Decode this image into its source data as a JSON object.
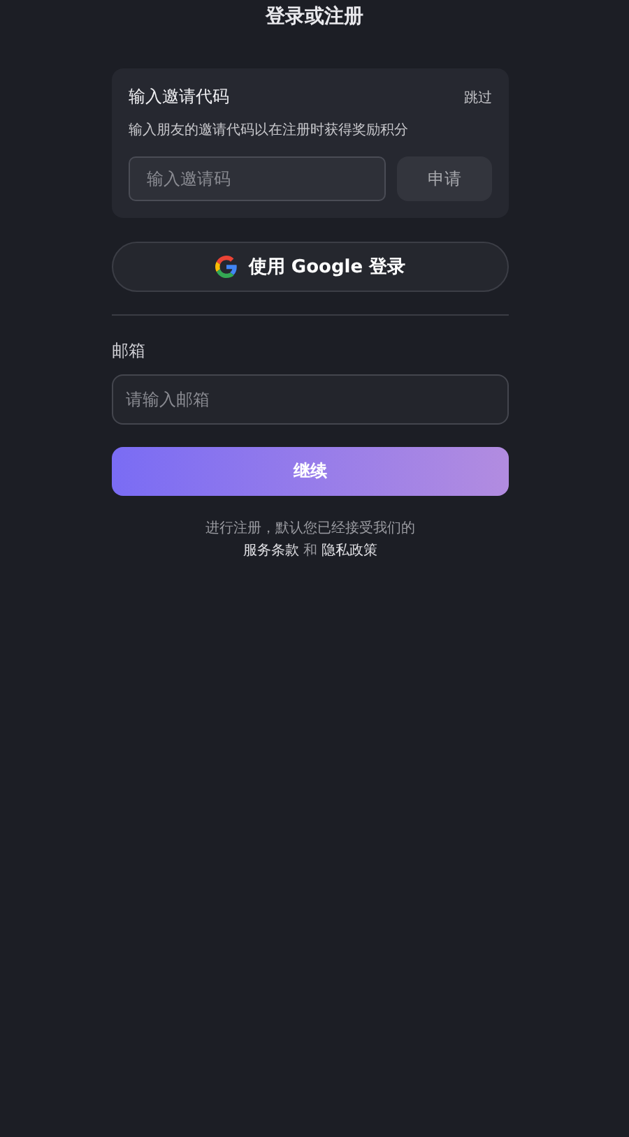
{
  "header": {
    "title": "登录或注册"
  },
  "invite_card": {
    "title": "输入邀请代码",
    "skip": "跳过",
    "description": "输入朋友的邀请代码以在注册时获得奖励积分",
    "code_field": {
      "placeholder": "输入邀请码"
    },
    "apply_button": "申请"
  },
  "google_button": {
    "label": "使用 Google 登录"
  },
  "email": {
    "label": "邮箱",
    "field": {
      "placeholder": "请输入邮箱"
    }
  },
  "continue_button": "继续",
  "terms": {
    "text": "进行注册，默认您已经接受我们的",
    "terms_link": "服务条款",
    "joiner": "和",
    "privacy_link": "隐私政策"
  }
}
